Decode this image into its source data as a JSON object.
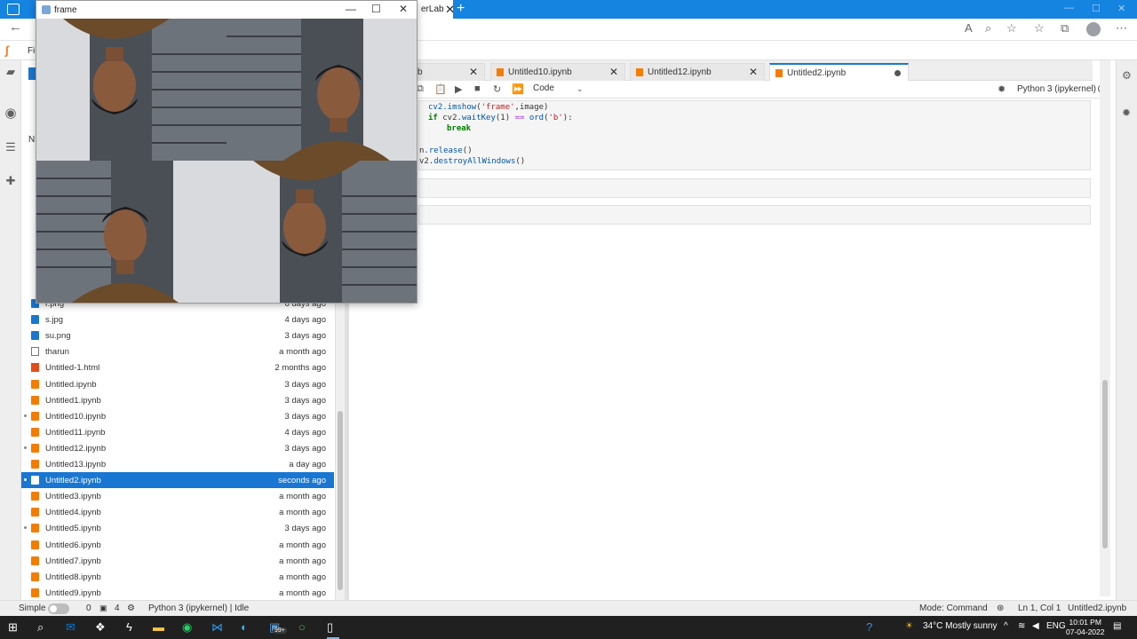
{
  "browser": {
    "partial_tab_label": "erLab",
    "new_tab_symbol": "+"
  },
  "frame_window": {
    "title": "frame",
    "minimize": "—",
    "maximize": "☐",
    "close": "✕"
  },
  "menubar": {
    "file_label": "File"
  },
  "file_browser": {
    "column_name": "N",
    "files": [
      {
        "name": "r.png",
        "modified": "6 days ago",
        "type": "img",
        "dot": false,
        "selected": false
      },
      {
        "name": "s.jpg",
        "modified": "4 days ago",
        "type": "img",
        "dot": false,
        "selected": false
      },
      {
        "name": "su.png",
        "modified": "3 days ago",
        "type": "img",
        "dot": false,
        "selected": false
      },
      {
        "name": "tharun",
        "modified": "a month ago",
        "type": "doc",
        "dot": false,
        "selected": false
      },
      {
        "name": "Untitled-1.html",
        "modified": "2 months ago",
        "type": "html",
        "dot": false,
        "selected": false
      },
      {
        "name": "Untitled.ipynb",
        "modified": "3 days ago",
        "type": "nb",
        "dot": false,
        "selected": false
      },
      {
        "name": "Untitled1.ipynb",
        "modified": "3 days ago",
        "type": "nb",
        "dot": false,
        "selected": false
      },
      {
        "name": "Untitled10.ipynb",
        "modified": "3 days ago",
        "type": "nb",
        "dot": true,
        "selected": false
      },
      {
        "name": "Untitled11.ipynb",
        "modified": "4 days ago",
        "type": "nb",
        "dot": false,
        "selected": false
      },
      {
        "name": "Untitled12.ipynb",
        "modified": "3 days ago",
        "type": "nb",
        "dot": true,
        "selected": false
      },
      {
        "name": "Untitled13.ipynb",
        "modified": "a day ago",
        "type": "nb",
        "dot": false,
        "selected": false
      },
      {
        "name": "Untitled2.ipynb",
        "modified": "seconds ago",
        "type": "nb",
        "dot": true,
        "selected": true
      },
      {
        "name": "Untitled3.ipynb",
        "modified": "a month ago",
        "type": "nb",
        "dot": false,
        "selected": false
      },
      {
        "name": "Untitled4.ipynb",
        "modified": "a month ago",
        "type": "nb",
        "dot": false,
        "selected": false
      },
      {
        "name": "Untitled5.ipynb",
        "modified": "3 days ago",
        "type": "nb",
        "dot": true,
        "selected": false
      },
      {
        "name": "Untitled6.ipynb",
        "modified": "a month ago",
        "type": "nb",
        "dot": false,
        "selected": false
      },
      {
        "name": "Untitled7.ipynb",
        "modified": "a month ago",
        "type": "nb",
        "dot": false,
        "selected": false
      },
      {
        "name": "Untitled8.ipynb",
        "modified": "a month ago",
        "type": "nb",
        "dot": false,
        "selected": false
      },
      {
        "name": "Untitled9.ipynb",
        "modified": "a month ago",
        "type": "nb",
        "dot": false,
        "selected": false
      }
    ]
  },
  "notebook_tabs": [
    {
      "label": "b",
      "state": "close",
      "active": false
    },
    {
      "label": "Untitled10.ipynb",
      "state": "close",
      "active": false
    },
    {
      "label": "Untitled12.ipynb",
      "state": "close",
      "active": false
    },
    {
      "label": "Untitled2.ipynb",
      "state": "unsaved",
      "active": true
    }
  ],
  "notebook_toolbar": {
    "cell_type": "Code",
    "kernel_name": "Python 3 (ipykernel)"
  },
  "code_lines": [
    "cv2.imshow('frame',image)",
    "if cv2.waitKey(1) == ord('b'):",
    "    break",
    "",
    ".release()",
    "2.destroyAllWindows()"
  ],
  "status_bar": {
    "mode_simple": "Simple",
    "count_a": "0",
    "count_b": "4",
    "kernel_status": "Python 3 (ipykernel) | Idle",
    "mode": "Mode: Command",
    "cursor": "Ln 1, Col 1",
    "filename": "Untitled2.ipynb"
  },
  "taskbar": {
    "badge": "99+",
    "weather": "34°C  Mostly sunny",
    "language": "ENG",
    "time": "10:01 PM",
    "date": "07-04-2022"
  },
  "colors": {
    "accent": "#1976d2",
    "notebook_icon": "#f57c00",
    "browser_titlebar": "#1583e0",
    "taskbar": "#202020"
  }
}
